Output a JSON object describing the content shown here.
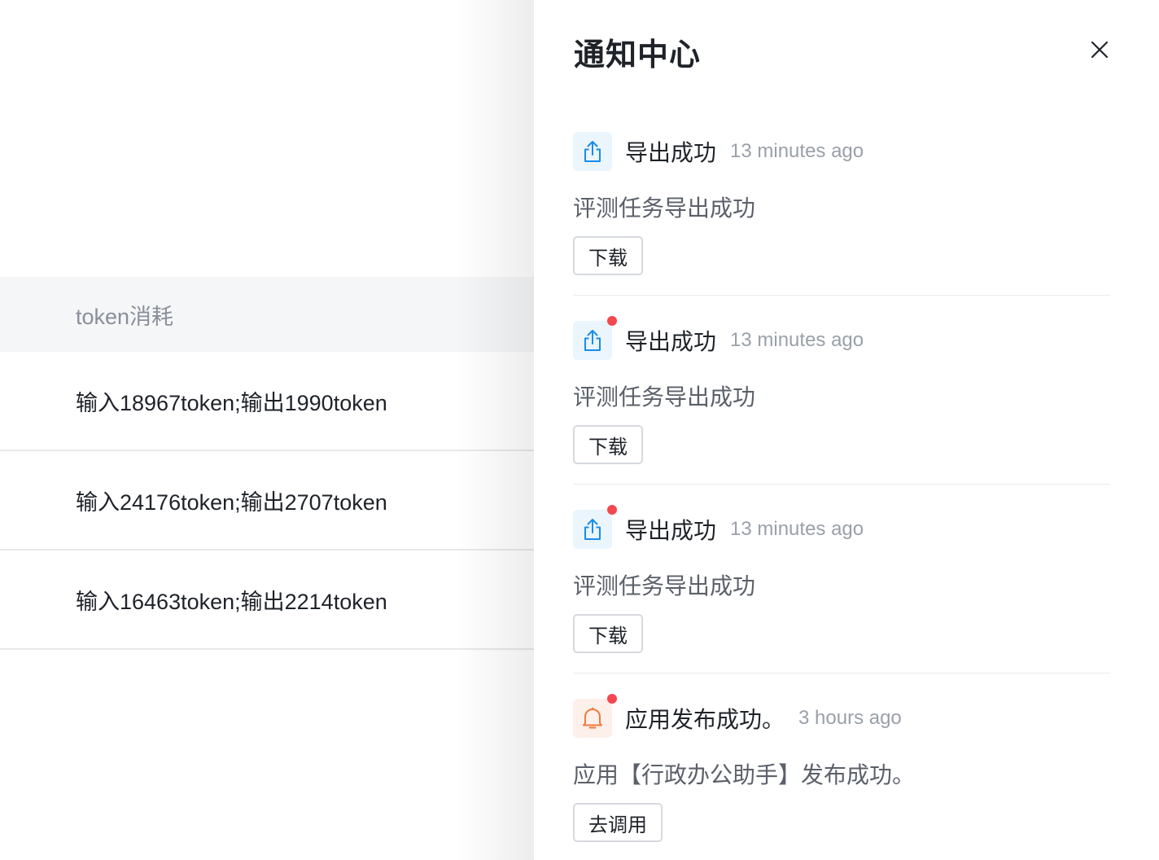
{
  "table": {
    "header": "token消耗",
    "rows": [
      "输入18967token;输出1990token",
      "输入24176token;输出2707token",
      "输入16463token;输出2214token"
    ]
  },
  "drawer": {
    "title": "通知中心",
    "close_icon": "close-icon",
    "notifications": [
      {
        "icon": "export-icon",
        "unread": false,
        "title": "导出成功",
        "time": "13 minutes ago",
        "description": "评测任务导出成功",
        "action": "下载"
      },
      {
        "icon": "export-icon",
        "unread": true,
        "title": "导出成功",
        "time": "13 minutes ago",
        "description": "评测任务导出成功",
        "action": "下载"
      },
      {
        "icon": "export-icon",
        "unread": true,
        "title": "导出成功",
        "time": "13 minutes ago",
        "description": "评测任务导出成功",
        "action": "下载"
      },
      {
        "icon": "bell-icon",
        "unread": true,
        "title": "应用发布成功。",
        "time": "3 hours ago",
        "description": "应用【行政办公助手】发布成功。",
        "action": "去调用"
      }
    ]
  },
  "colors": {
    "export_icon": "#1a8ce8",
    "bell_icon": "#f0793c",
    "unread_dot": "#f5474f"
  }
}
